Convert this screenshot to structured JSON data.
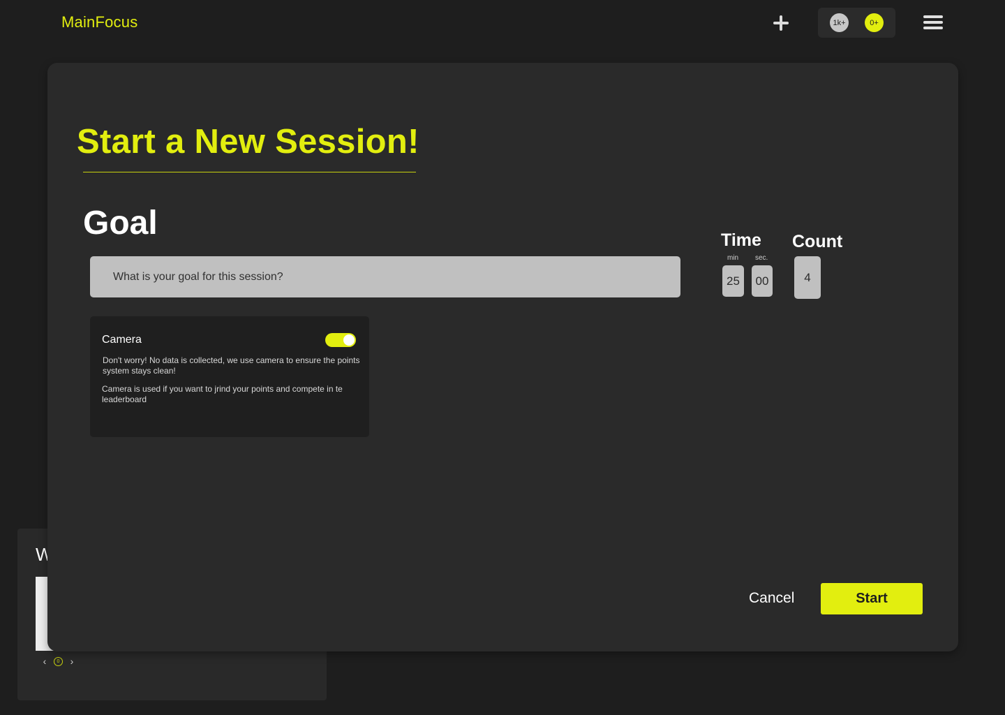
{
  "app": {
    "brand": "MainFocus"
  },
  "header": {
    "add_icon": "plus-icon",
    "badges": [
      {
        "label": "1k+",
        "color": "#c7c7c7"
      },
      {
        "label": "0+",
        "color": "#e2ee0f"
      }
    ],
    "menu_icon": "hamburger-menu-icon"
  },
  "background_card": {
    "title_fragment": "W",
    "nav": {
      "prev": "‹",
      "indicator": "0",
      "next": "›"
    }
  },
  "modal": {
    "title": "Start a New Session!",
    "goal": {
      "heading": "Goal",
      "placeholder": "What is your goal for this session?",
      "value": ""
    },
    "camera": {
      "label": "Camera",
      "enabled": true,
      "description_1": "Don't worry! No data is collected, we use camera to ensure the points system stays clean!",
      "description_2": "Camera is used if you want to jrind your points and compete in te leaderboard"
    },
    "time": {
      "label": "Time",
      "min_label": "min",
      "sec_label": "sec.",
      "minutes": "25",
      "seconds": "00"
    },
    "count": {
      "label": "Count",
      "value": "4"
    },
    "actions": {
      "cancel": "Cancel",
      "start": "Start"
    }
  },
  "colors": {
    "accent": "#e2ee0f",
    "background": "#1e1e1e",
    "panel": "#2a2a2a",
    "input": "#c0c0c0"
  }
}
